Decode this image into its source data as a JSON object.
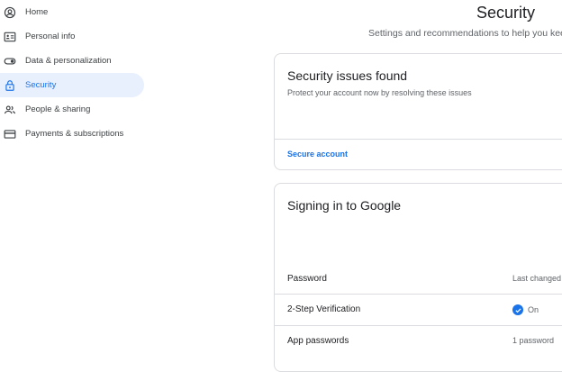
{
  "sidebar": {
    "items": [
      {
        "label": "Home",
        "icon": "account-circle-icon"
      },
      {
        "label": "Personal info",
        "icon": "id-card-icon"
      },
      {
        "label": "Data & personalization",
        "icon": "toggle-icon"
      },
      {
        "label": "Security",
        "icon": "lock-icon",
        "active": true
      },
      {
        "label": "People & sharing",
        "icon": "people-icon"
      },
      {
        "label": "Payments & subscriptions",
        "icon": "credit-card-icon"
      }
    ]
  },
  "header": {
    "title": "Security",
    "subtitle": "Settings and recommendations to help you keep"
  },
  "issues_card": {
    "title": "Security issues found",
    "description": "Protect your account now by resolving these issues",
    "action_label": "Secure account"
  },
  "signin_card": {
    "title": "Signing in to Google",
    "rows": [
      {
        "label": "Password",
        "value": "Last changed"
      },
      {
        "label": "2-Step Verification",
        "value": "On"
      },
      {
        "label": "App passwords",
        "value": "1 password"
      }
    ]
  },
  "colors": {
    "accent": "#1a73e8",
    "active_bg": "#e8f0fe",
    "divider": "#dadce0"
  }
}
